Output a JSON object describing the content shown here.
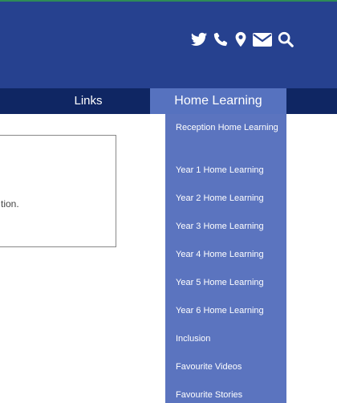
{
  "header": {
    "icons": [
      "twitter-icon",
      "phone-icon",
      "location-pin-icon",
      "email-icon",
      "search-icon"
    ]
  },
  "nav": {
    "items": [
      {
        "label": "Links"
      },
      {
        "label": "Home Learning"
      }
    ]
  },
  "content": {
    "text": "tion."
  },
  "dropdown": {
    "items": [
      {
        "label": "Reception Home Learning"
      },
      {
        "label": "Year 1 Home Learning"
      },
      {
        "label": "Year 2 Home Learning"
      },
      {
        "label": "Year 3 Home Learning"
      },
      {
        "label": "Year 4 Home Learning"
      },
      {
        "label": "Year 5 Home Learning"
      },
      {
        "label": "Year 6 Home Learning"
      },
      {
        "label": "Inclusion"
      },
      {
        "label": "Favourite Videos"
      },
      {
        "label": "Favourite Stories"
      }
    ]
  },
  "colors": {
    "header_bg": "#26418f",
    "navbar_bg": "#0f2663",
    "active_tab_bg": "#5672bf",
    "dropdown_bg": "#5b74bf",
    "top_line": "#2e8b57"
  }
}
